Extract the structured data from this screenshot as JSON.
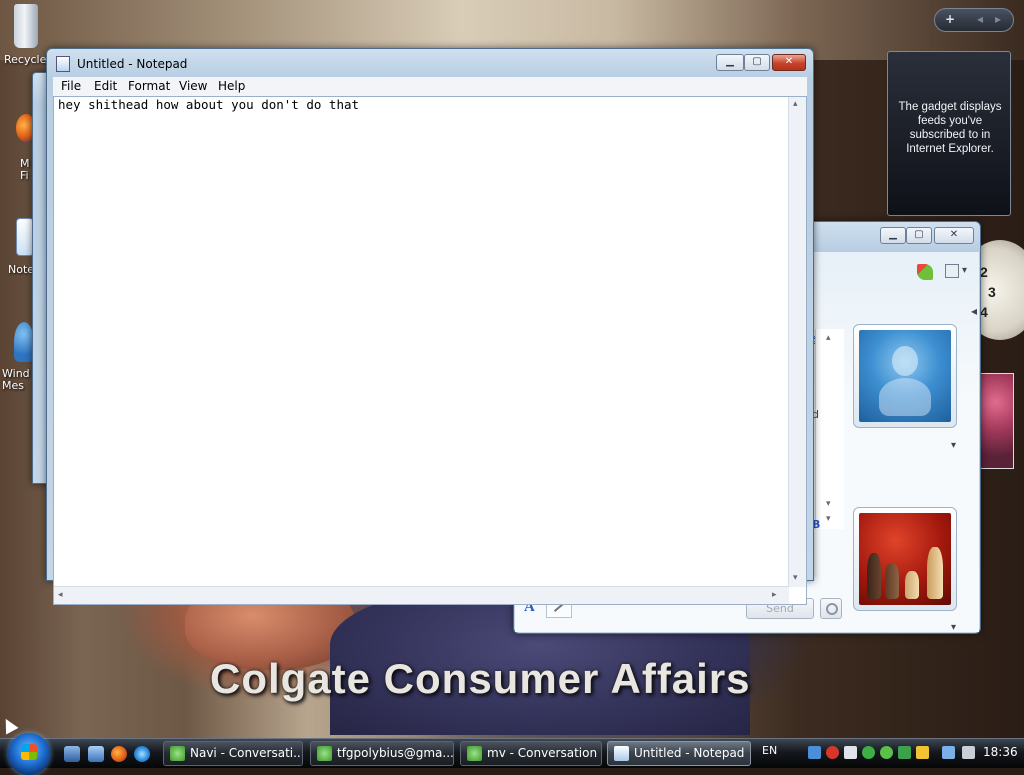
{
  "desktop": {
    "icons": [
      {
        "label": "Recycle",
        "icon": "recycle-bin-icon"
      },
      {
        "label": "M\nFi",
        "icon": "firefox-icon"
      },
      {
        "label": "Note",
        "icon": "notepad-icon"
      },
      {
        "label": "Wind\nMes",
        "icon": "messenger-icon"
      }
    ],
    "wallpaper_caption": "Colgate Consumer Affairs"
  },
  "gadgets": {
    "toolbar": {
      "add": "+",
      "prev": "◂",
      "next": "▸"
    },
    "feed_text": "The gadget displays feeds you've subscribed to in Internet Explorer.",
    "clock_numbers": [
      "2",
      "3",
      "4"
    ]
  },
  "notepad": {
    "title": "Untitled - Notepad",
    "menu": [
      "File",
      "Edit",
      "Format",
      "View",
      "Help"
    ],
    "content": "hey shithead how about you don't do that",
    "buttons": {
      "minimize": "▁",
      "maximize": "▢",
      "close": "✕"
    }
  },
  "messenger": {
    "send_label": "Send",
    "link_fragment": "s",
    "buttons": {
      "minimize": "▁",
      "maximize": "▢",
      "close": "✕"
    },
    "expand_arrow": "◂",
    "dropdown_arrow": "▾",
    "font_button": "A",
    "scroll_up": "▴",
    "scroll_down": "▾",
    "side_letter_1": "d",
    "side_letter_2": "B"
  },
  "taskbar": {
    "tasks": [
      {
        "label": "Navi - Conversati...",
        "icon": "messenger-icon",
        "active": false
      },
      {
        "label": "tfgpolybius@gma...",
        "icon": "messenger-icon",
        "active": false
      },
      {
        "label": "mv - Conversation",
        "icon": "messenger-icon",
        "active": false
      },
      {
        "label": "Untitled - Notepad",
        "icon": "notepad-icon",
        "active": true
      }
    ],
    "language": "EN",
    "time": "18:36"
  },
  "colors": {
    "accent": "#1f6fd1",
    "close_red": "#c9432a",
    "link_blue": "#2855c8"
  }
}
